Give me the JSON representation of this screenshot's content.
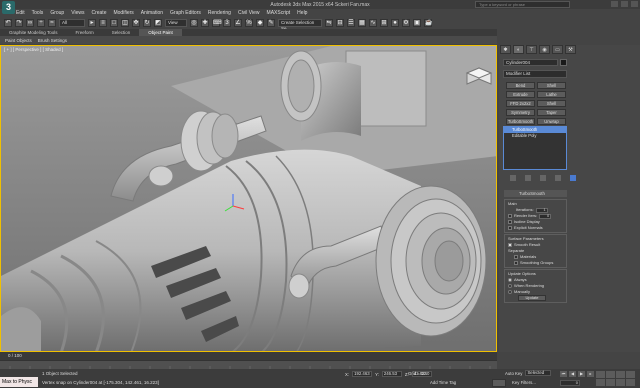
{
  "title_bar": {
    "logo": "3",
    "title": "Autodesk 3ds Max 2015 x64   Sckeri Fan.max",
    "search_placeholder": "Type a keyword or phrase"
  },
  "menu": [
    "Edit",
    "Tools",
    "Group",
    "Views",
    "Create",
    "Modifiers",
    "Animation",
    "Graph Editors",
    "Rendering",
    "Civil View",
    "MAXScript",
    "Help"
  ],
  "main_toolbar": {
    "selection_filter": "All",
    "view_coord": "View",
    "named_selection": "Create Selection Se"
  },
  "ribbon": {
    "tabs": [
      "Graphite Modeling Tools",
      "Freeform",
      "Selection",
      "Object Paint"
    ],
    "active_tab": 3,
    "subitems": [
      "Paint Objects",
      "Brush Settings"
    ]
  },
  "viewport": {
    "label": "[ + ] [ Perspective ] [ Shaded ]"
  },
  "command_panel": {
    "object_name": "Cylinder004",
    "modifier_list": "Modifier List",
    "modifier_buttons": [
      "Bend",
      "Shell",
      "Extrude",
      "Lathe",
      "FFD 2x2x2",
      "Shell",
      "Symmetry",
      "Taper",
      "TurboSmooth",
      "Unwrap"
    ],
    "stack": [
      {
        "label": "TurboSmooth",
        "selected": true
      },
      {
        "label": "Editable Poly",
        "selected": false
      }
    ],
    "rollout_title": "TurboSmooth",
    "main_label": "Main",
    "iterations_label": "Iterations:",
    "iterations_value": "1",
    "render_iters_label": "Render Iters:",
    "render_iters_value": "0",
    "isoline_label": "Isoline Display",
    "explicit_label": "Explicit Normals",
    "surface_label": "Surface Parameters",
    "smooth_result_label": "Smooth Result",
    "separate_label": "Separate",
    "materials_label": "Materials",
    "smoothing_groups_label": "Smoothing Groups",
    "update_options_label": "Update Options",
    "always_label": "Always",
    "when_rendering_label": "When Rendering",
    "manually_label": "Manually",
    "update_button": "Update"
  },
  "time_slider": {
    "label": "0 / 100"
  },
  "status": {
    "maxscript_text": "Max to Physc",
    "selected_text": "1 Object Selected",
    "snap_text": "Vertex snap on Cylinder004 at [-175.304, 142.461, 16.223]",
    "x_label": "X:",
    "x_value": "192.463",
    "y_label": "Y:",
    "y_value": "246.53",
    "z_label": "Z:",
    "z_value": "43.834",
    "grid_text": "Grid = 10.0",
    "add_time_tag": "Add Time Tag",
    "auto_key": "Auto Key",
    "selected_option": "Selected",
    "set_key": "Set Key",
    "key_filters": "Key Filters...",
    "frame_value": "0"
  }
}
